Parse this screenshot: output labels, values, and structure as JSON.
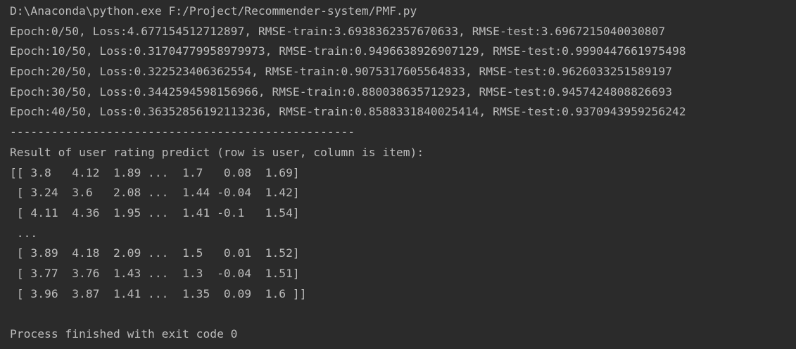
{
  "console": {
    "command_line": "D:\\Anaconda\\python.exe F:/Project/Recommender-system/PMF.py",
    "epoch_lines": [
      "Epoch:0/50, Loss:4.677154512712897, RMSE-train:3.6938362357670633, RMSE-test:3.6967215040030807",
      "Epoch:10/50, Loss:0.31704779958979973, RMSE-train:0.9496638926907129, RMSE-test:0.9990447661975498",
      "Epoch:20/50, Loss:0.322523406362554, RMSE-train:0.9075317605564833, RMSE-test:0.9626033251589197",
      "Epoch:30/50, Loss:0.3442594598156966, RMSE-train:0.880038635712923, RMSE-test:0.9457424808826693",
      "Epoch:40/50, Loss:0.36352856192113236, RMSE-train:0.8588331840025414, RMSE-test:0.9370943959256242"
    ],
    "separator": "--------------------------------------------------",
    "result_header": "Result of user rating predict (row is user, column is item):",
    "matrix_lines": [
      "[[ 3.8   4.12  1.89 ...  1.7   0.08  1.69]",
      " [ 3.24  3.6   2.08 ...  1.44 -0.04  1.42]",
      " [ 4.11  4.36  1.95 ...  1.41 -0.1   1.54]",
      " ...",
      " [ 3.89  4.18  2.09 ...  1.5   0.01  1.52]",
      " [ 3.77  3.76  1.43 ...  1.3  -0.04  1.51]",
      " [ 3.96  3.87  1.41 ...  1.35  0.09  1.6 ]]"
    ],
    "blank_line": "",
    "exit_message": "Process finished with exit code 0"
  },
  "colors": {
    "background": "#2b2b2b",
    "text": "#bbbbbb"
  }
}
